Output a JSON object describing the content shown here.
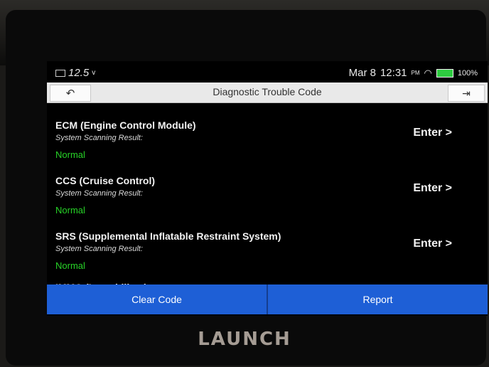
{
  "status_bar": {
    "voltage": "12.5",
    "voltage_unit": "v",
    "date": "Mar 8",
    "time": "12:31",
    "ampm": "PM",
    "battery_percent": "100%",
    "battery_level": 1.0
  },
  "header": {
    "title": "Diagnostic Trouble Code",
    "back_icon": "back-arrow-icon",
    "exit_icon": "exit-icon"
  },
  "modules": [
    {
      "name": "ECM (Engine Control Module)",
      "sublabel": "System Scanning Result:",
      "status": "Normal",
      "enter": "Enter >"
    },
    {
      "name": "CCS (Cruise Control)",
      "sublabel": "System Scanning Result:",
      "status": "Normal",
      "enter": "Enter >"
    },
    {
      "name": "SRS (Supplemental Inflatable Restraint System)",
      "sublabel": "System Scanning Result:",
      "status": "Normal",
      "enter": "Enter >"
    },
    {
      "name": "IMMO (Immobilizer)",
      "sublabel": "",
      "status": "",
      "enter": ""
    }
  ],
  "actions": {
    "clear_code": "Clear Code",
    "report": "Report"
  },
  "device": {
    "brand": "LAUNCH"
  },
  "colors": {
    "status_ok": "#27d327",
    "action_blue": "#1e5fd6",
    "battery_green": "#2ecc40"
  }
}
